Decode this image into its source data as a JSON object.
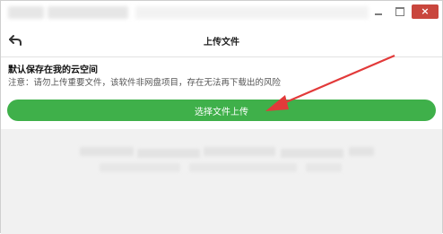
{
  "header": {
    "title": "上传文件"
  },
  "content": {
    "heading": "默认保存在我的云空间",
    "notice": "注意：请勿上传重要文件，该软件非网盘项目，存在无法再下载出的风险"
  },
  "upload_button": {
    "label": "选择文件上传"
  },
  "window_controls": {
    "close_symbol": "×"
  },
  "colors": {
    "accent_green": "#3fb04a",
    "close_red": "#c9463d",
    "annotation_arrow": "#e23a3a"
  },
  "icons": {
    "back": "back-arrow-icon",
    "minimize": "minimize-icon",
    "maximize": "maximize-icon",
    "close": "close-icon"
  }
}
